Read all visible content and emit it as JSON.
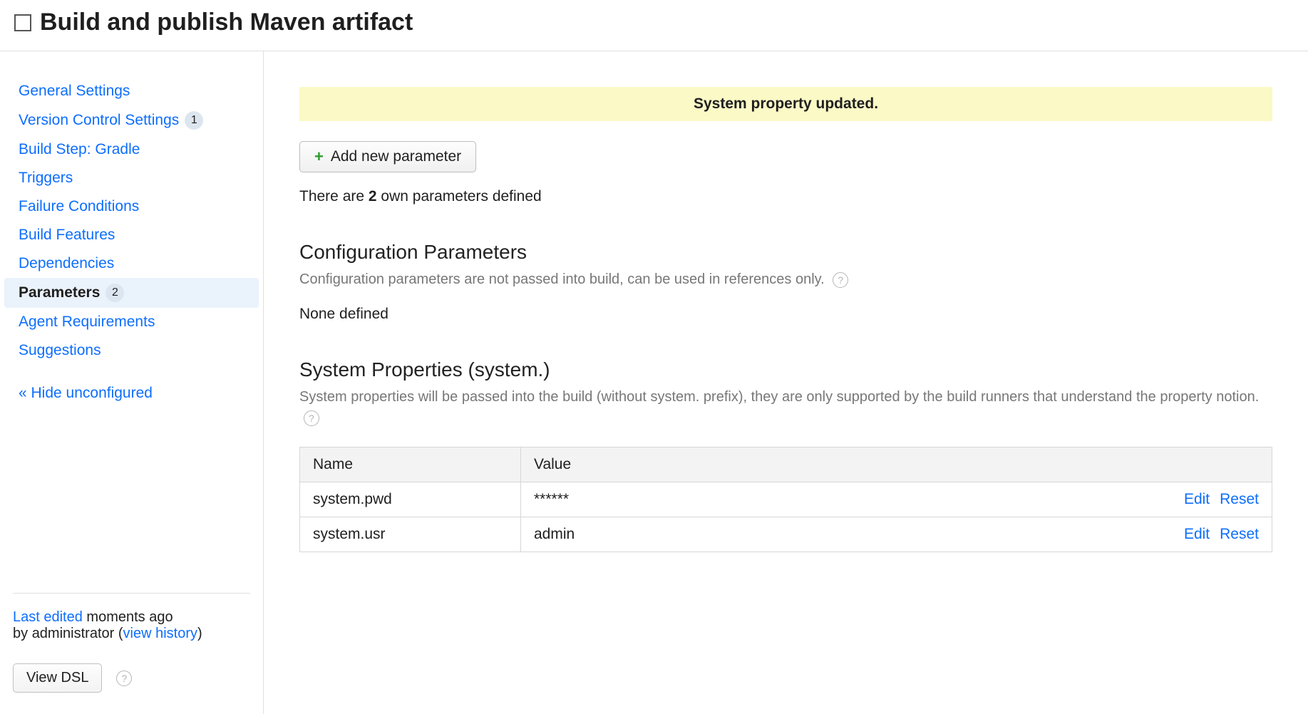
{
  "header": {
    "title": "Build and publish Maven artifact"
  },
  "sidebar": {
    "items": [
      {
        "label": "General Settings",
        "badge": null,
        "active": false
      },
      {
        "label": "Version Control Settings",
        "badge": "1",
        "active": false
      },
      {
        "label": "Build Step: Gradle",
        "badge": null,
        "active": false
      },
      {
        "label": "Triggers",
        "badge": null,
        "active": false
      },
      {
        "label": "Failure Conditions",
        "badge": null,
        "active": false
      },
      {
        "label": "Build Features",
        "badge": null,
        "active": false
      },
      {
        "label": "Dependencies",
        "badge": null,
        "active": false
      },
      {
        "label": "Parameters",
        "badge": "2",
        "active": true
      },
      {
        "label": "Agent Requirements",
        "badge": null,
        "active": false
      },
      {
        "label": "Suggestions",
        "badge": null,
        "active": false
      }
    ],
    "hide_label": "« Hide unconfigured",
    "footer": {
      "edited_prefix": "Last edited",
      "edited_when": " moments ago",
      "by_prefix": "by ",
      "by_who": "administrator",
      "history_open": "  (",
      "history_label": "view history",
      "history_close": ")",
      "view_dsl": "View DSL"
    }
  },
  "main": {
    "notice": "System property updated.",
    "add_button": "Add new parameter",
    "count_prefix": "There are ",
    "count_number": "2",
    "count_suffix": " own parameters defined",
    "config": {
      "heading": "Configuration Parameters",
      "desc": "Configuration parameters are not passed into build, can be used in references only.",
      "none": "None defined"
    },
    "system": {
      "heading": "System Properties (system.)",
      "desc": "System properties will be passed into the build (without system. prefix), they are only supported by the build runners that understand the property notion.",
      "table": {
        "col_name": "Name",
        "col_value": "Value",
        "rows": [
          {
            "name": "system.pwd",
            "value": "******"
          },
          {
            "name": "system.usr",
            "value": "admin"
          }
        ],
        "edit": "Edit",
        "reset": "Reset"
      }
    }
  }
}
